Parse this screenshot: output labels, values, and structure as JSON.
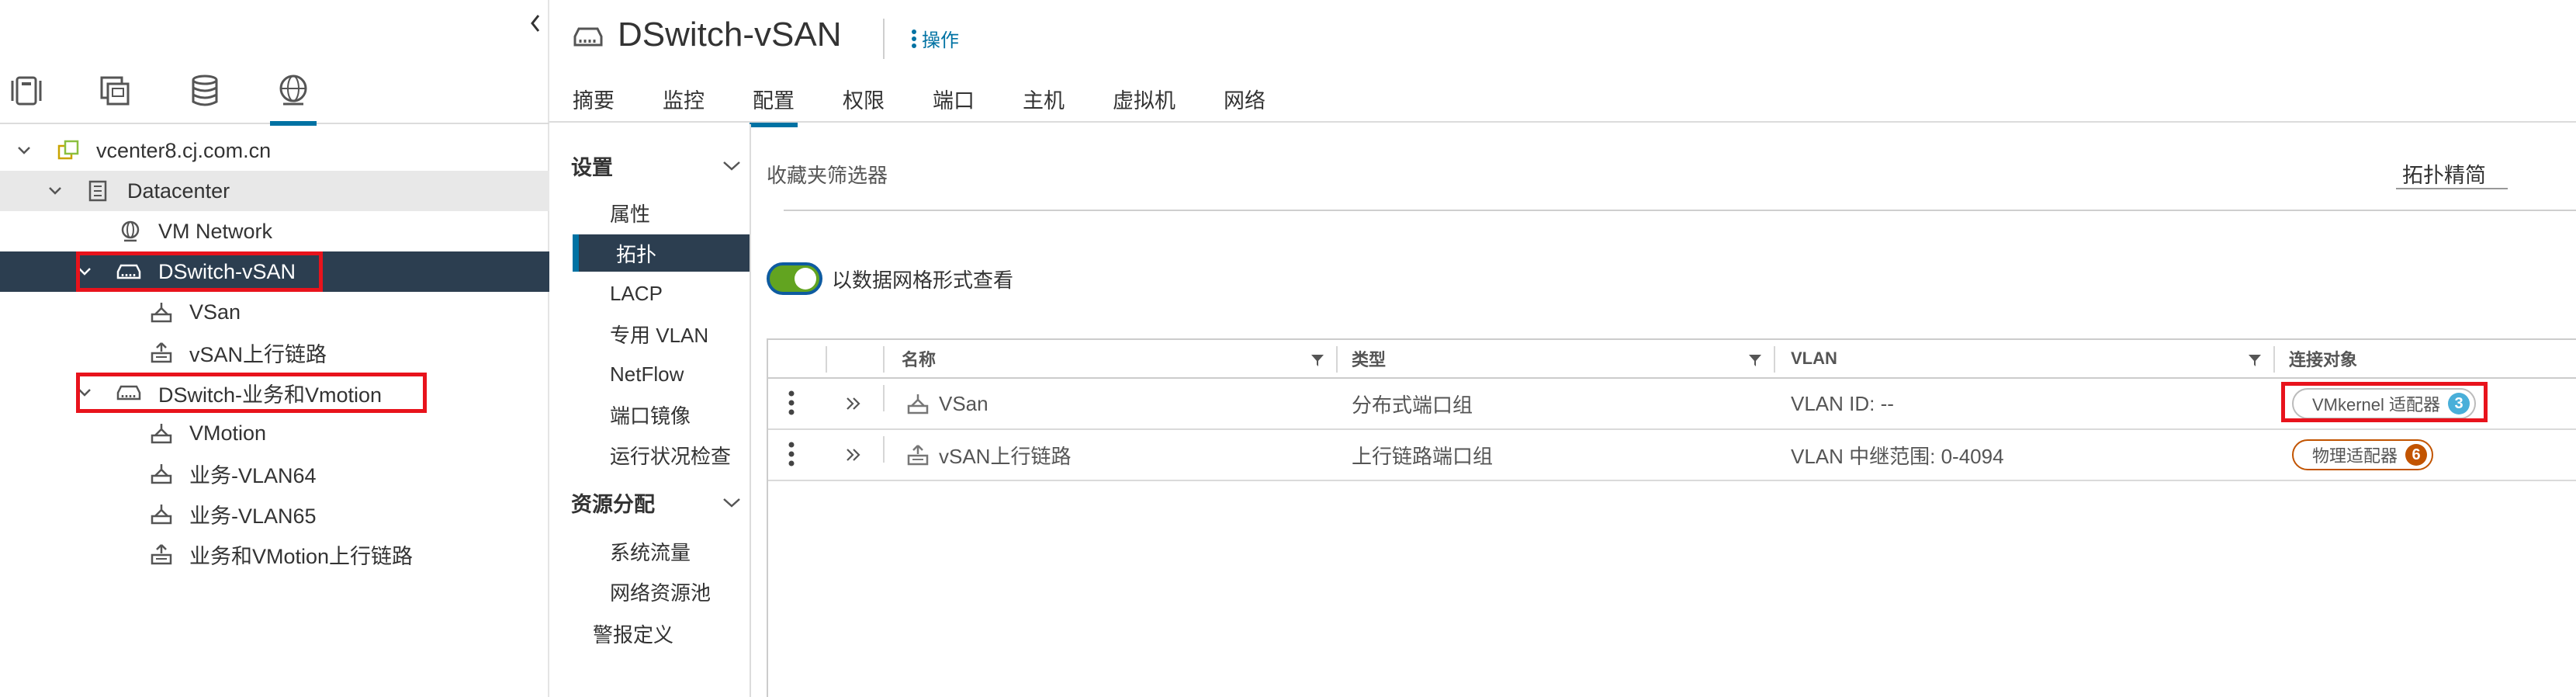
{
  "navigator": {
    "tabs": [
      "hosts-clusters",
      "vms-templates",
      "storage",
      "networking"
    ],
    "tree": [
      {
        "label": "vcenter8.cj.com.cn",
        "level": 0,
        "expanded": true
      },
      {
        "label": "Datacenter",
        "level": 1,
        "expanded": true
      },
      {
        "label": "VM Network",
        "level": 2
      },
      {
        "label": "DSwitch-vSAN",
        "level": 2,
        "expanded": true,
        "selected": true
      },
      {
        "label": "VSan",
        "level": 3
      },
      {
        "label": "vSAN上行链路",
        "level": 3
      },
      {
        "label": "DSwitch-业务和Vmotion",
        "level": 2,
        "expanded": true
      },
      {
        "label": "VMotion",
        "level": 3
      },
      {
        "label": "业务-VLAN64",
        "level": 3
      },
      {
        "label": "业务-VLAN65",
        "level": 3
      },
      {
        "label": "业务和VMotion上行链路",
        "level": 3
      }
    ]
  },
  "header": {
    "title": "DSwitch-vSAN",
    "actions_label": "操作",
    "tabs": [
      "摘要",
      "监控",
      "配置",
      "权限",
      "端口",
      "主机",
      "虚拟机",
      "网络"
    ],
    "active_tab": "配置"
  },
  "settings_nav": {
    "group1": "设置",
    "items1": [
      "属性",
      "拓扑",
      "LACP",
      "专用 VLAN",
      "NetFlow",
      "端口镜像",
      "运行状况检查"
    ],
    "active_item": "拓扑",
    "group2": "资源分配",
    "items2": [
      "系统流量",
      "网络资源池"
    ],
    "alarm_defs": "警报定义"
  },
  "main": {
    "filter_label": "收藏夹筛选器",
    "view_select": "拓扑精简",
    "toggle_label": "以数据网格形式查看",
    "toggle_on": true,
    "columns": [
      "名称",
      "类型",
      "VLAN",
      "连接对象"
    ],
    "rows": [
      {
        "name": "VSan",
        "type": "分布式端口组",
        "vlan": "VLAN ID: --",
        "connected_label": "VMkernel 适配器",
        "connected_count": "3",
        "badge_color": "#49afd9"
      },
      {
        "name": "vSAN上行链路",
        "type": "上行链路端口组",
        "vlan": "VLAN 中继范围: 0-4094",
        "connected_label": "物理适配器",
        "connected_count": "6",
        "badge_color": "#c25400"
      }
    ]
  },
  "colors": {
    "accent": "#0072a3",
    "selected_bg": "#2c3e50",
    "highlight_box": "#e8131c",
    "toggle_on": "#62a420"
  }
}
